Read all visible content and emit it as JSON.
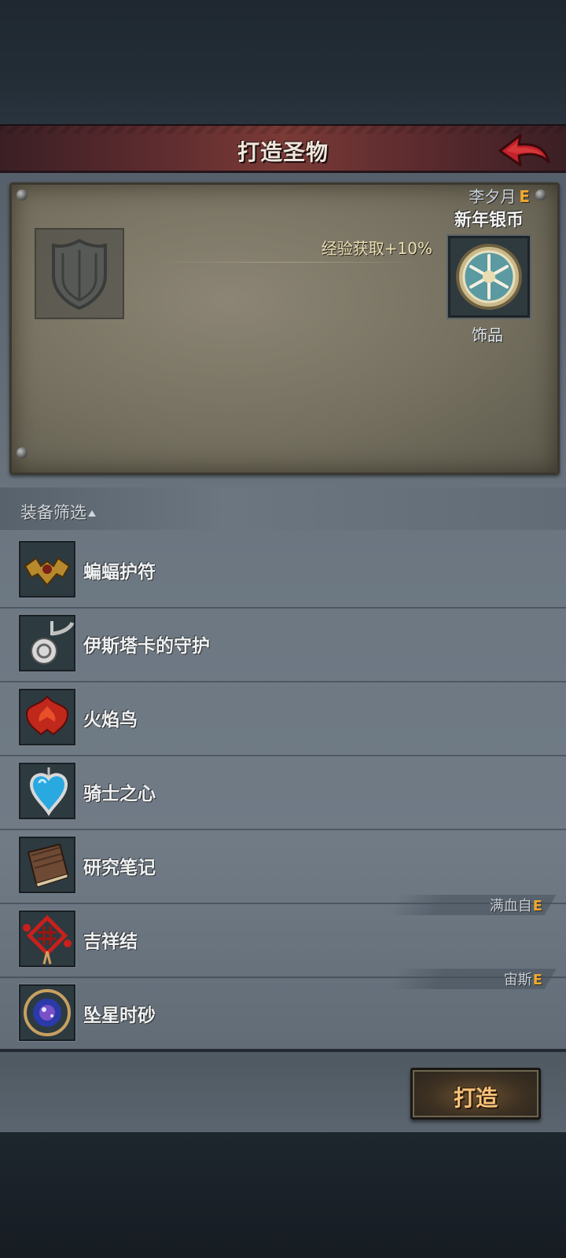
{
  "header": {
    "title": "打造圣物",
    "back_icon": "back-arrow-icon"
  },
  "preview": {
    "owner_name": "李夕月",
    "owner_grade": "E",
    "item_name": "新年银币",
    "item_icon": "silver-coin-icon",
    "stat": "经验获取+10%",
    "item_type": "饰品",
    "empty_slot_icon": "shield-slot-icon"
  },
  "filter": {
    "label": "装备筛选"
  },
  "items": [
    {
      "name": "蝙蝠护符",
      "icon": "bat-amulet-icon"
    },
    {
      "name": "伊斯塔卡的守护",
      "icon": "silver-spiral-icon"
    },
    {
      "name": "火焰鸟",
      "icon": "firebird-icon"
    },
    {
      "name": "骑士之心",
      "icon": "heart-pendant-icon"
    },
    {
      "name": "研究笔记",
      "icon": "notebook-icon"
    },
    {
      "name": "吉祥结",
      "icon": "chinese-knot-icon",
      "owner": "满血自",
      "owner_grade": "E"
    },
    {
      "name": "坠星时砂",
      "icon": "starfall-hourglass-icon",
      "owner": "宙斯",
      "owner_grade": "E"
    }
  ],
  "footer": {
    "forge_label": "打造"
  },
  "colors": {
    "grade_color": "#f0a830",
    "title_bar": "#7a3a36",
    "forge_text": "#f7c27a"
  }
}
